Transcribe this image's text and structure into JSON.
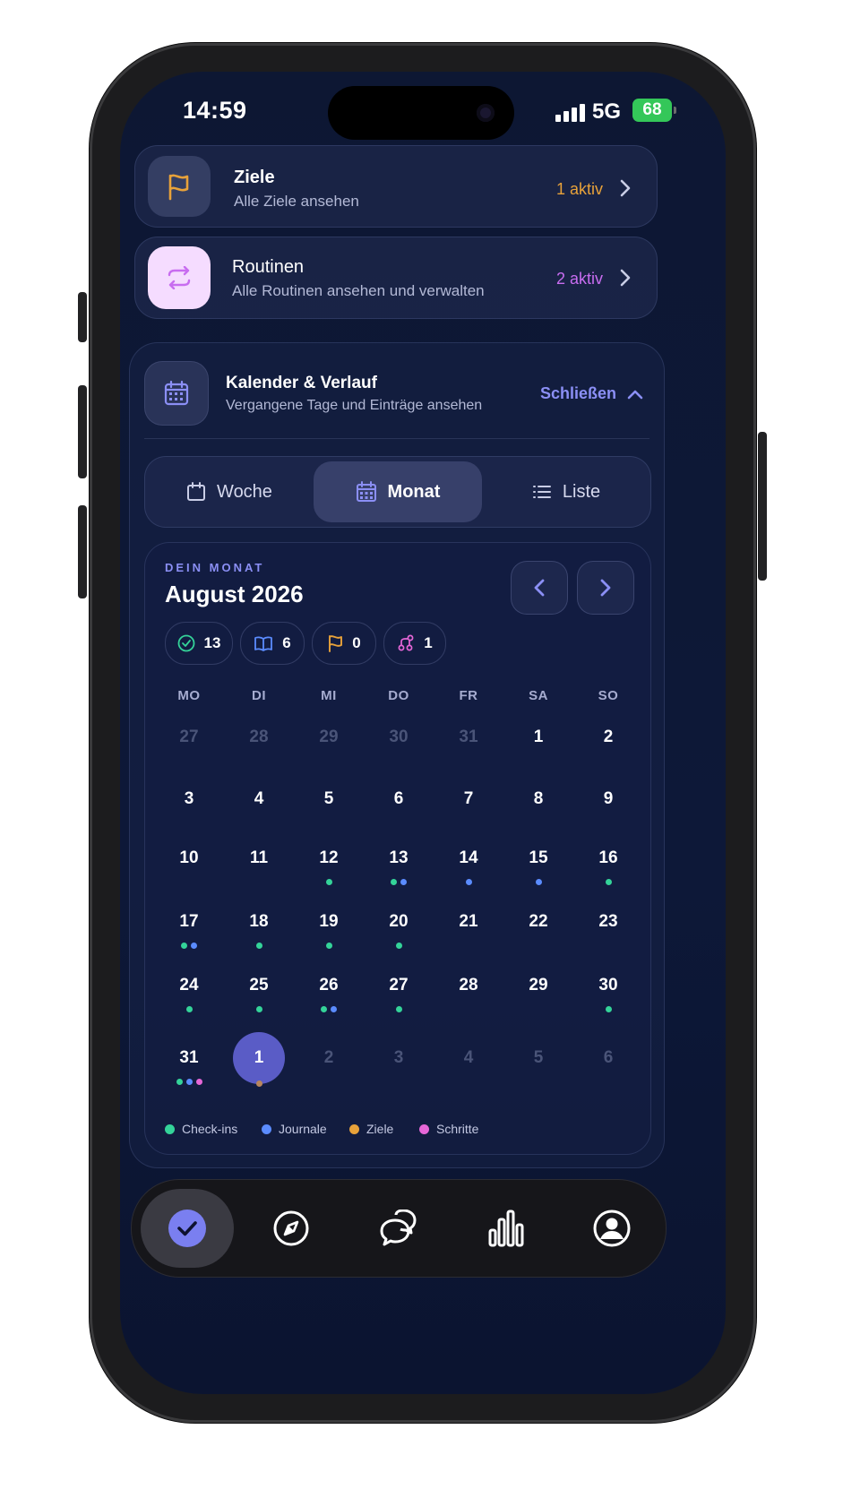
{
  "status": {
    "time": "14:59",
    "network": "5G",
    "battery": "68"
  },
  "rows": [
    {
      "title": "Ziele",
      "subtitle": "Alle Ziele ansehen",
      "count": "1 aktiv",
      "icon": "flag-icon",
      "accent": "#e8a23a"
    },
    {
      "title": "Routinen",
      "subtitle": "Alle Routinen ansehen und verwalten",
      "count": "2 aktiv",
      "icon": "repeat-icon",
      "accent": "#c86df0"
    }
  ],
  "calendar_section": {
    "title": "Kalender & Verlauf",
    "subtitle": "Vergangene Tage und Einträge ansehen",
    "close_label": "Schließen",
    "icon": "calendar-icon"
  },
  "view_tabs": [
    {
      "label": "Woche",
      "icon": "calendar-outline-icon",
      "active": false
    },
    {
      "label": "Monat",
      "icon": "calendar-grid-icon",
      "active": true
    },
    {
      "label": "Liste",
      "icon": "list-icon",
      "active": false
    }
  ],
  "month": {
    "eyebrow": "DEIN MONAT",
    "title": "August 2026",
    "stats": [
      {
        "icon": "check-circle-icon",
        "value": "13",
        "color": "#34d399"
      },
      {
        "icon": "book-icon",
        "value": "6",
        "color": "#5b8cff"
      },
      {
        "icon": "flag-icon",
        "value": "0",
        "color": "#e8a23a"
      },
      {
        "icon": "steps-icon",
        "value": "1",
        "color": "#e667d8"
      }
    ],
    "weekdays": [
      "MO",
      "DI",
      "MI",
      "DO",
      "FR",
      "SA",
      "SO"
    ],
    "weeks": [
      [
        {
          "d": "27",
          "m": true,
          "dots": []
        },
        {
          "d": "28",
          "m": true,
          "dots": []
        },
        {
          "d": "29",
          "m": true,
          "dots": []
        },
        {
          "d": "30",
          "m": true,
          "dots": []
        },
        {
          "d": "31",
          "m": true,
          "dots": []
        },
        {
          "d": "1",
          "dots": []
        },
        {
          "d": "2",
          "dots": []
        }
      ],
      [
        {
          "d": "3",
          "dots": []
        },
        {
          "d": "4",
          "dots": []
        },
        {
          "d": "5",
          "dots": []
        },
        {
          "d": "6",
          "dots": []
        },
        {
          "d": "7",
          "dots": []
        },
        {
          "d": "8",
          "dots": []
        },
        {
          "d": "9",
          "dots": []
        }
      ],
      [
        {
          "d": "10",
          "dots": []
        },
        {
          "d": "11",
          "dots": []
        },
        {
          "d": "12",
          "dots": [
            "checkin"
          ]
        },
        {
          "d": "13",
          "dots": [
            "checkin",
            "journal"
          ]
        },
        {
          "d": "14",
          "dots": [
            "journal"
          ]
        },
        {
          "d": "15",
          "dots": [
            "journal"
          ]
        },
        {
          "d": "16",
          "dots": [
            "checkin"
          ]
        }
      ],
      [
        {
          "d": "17",
          "dots": [
            "checkin",
            "journal"
          ]
        },
        {
          "d": "18",
          "dots": [
            "checkin"
          ]
        },
        {
          "d": "19",
          "dots": [
            "checkin"
          ]
        },
        {
          "d": "20",
          "dots": [
            "checkin"
          ]
        },
        {
          "d": "21",
          "dots": []
        },
        {
          "d": "22",
          "dots": []
        },
        {
          "d": "23",
          "dots": []
        }
      ],
      [
        {
          "d": "24",
          "dots": [
            "checkin"
          ]
        },
        {
          "d": "25",
          "dots": [
            "checkin"
          ]
        },
        {
          "d": "26",
          "dots": [
            "checkin",
            "journal"
          ]
        },
        {
          "d": "27",
          "dots": [
            "checkin"
          ]
        },
        {
          "d": "28",
          "dots": []
        },
        {
          "d": "29",
          "dots": []
        },
        {
          "d": "30",
          "dots": [
            "checkin"
          ]
        }
      ],
      [
        {
          "d": "31",
          "dots": [
            "checkin",
            "journal",
            "step"
          ]
        },
        {
          "d": "1",
          "today": true,
          "dots": [
            "today"
          ]
        },
        {
          "d": "2",
          "m": true,
          "dots": []
        },
        {
          "d": "3",
          "m": true,
          "dots": []
        },
        {
          "d": "4",
          "m": true,
          "dots": []
        },
        {
          "d": "5",
          "m": true,
          "dots": []
        },
        {
          "d": "6",
          "m": true,
          "dots": []
        }
      ]
    ],
    "legend": [
      {
        "key": "checkin",
        "label": "Check-ins",
        "color": "#34d399"
      },
      {
        "key": "journal",
        "label": "Journale",
        "color": "#5b8cff"
      },
      {
        "key": "goal",
        "label": "Ziele",
        "color": "#e8a23a"
      },
      {
        "key": "step",
        "label": "Schritte",
        "color": "#e667d8"
      }
    ]
  },
  "colors": {
    "accent": "#8b8ff5",
    "today": "#5a5cc6",
    "today_dot": "#b8865c"
  },
  "tabbar": [
    {
      "icon": "check-icon",
      "active": true
    },
    {
      "icon": "compass-icon",
      "active": false
    },
    {
      "icon": "chat-bubbles-icon",
      "active": false
    },
    {
      "icon": "bar-chart-icon",
      "active": false
    },
    {
      "icon": "profile-icon",
      "active": false
    }
  ]
}
